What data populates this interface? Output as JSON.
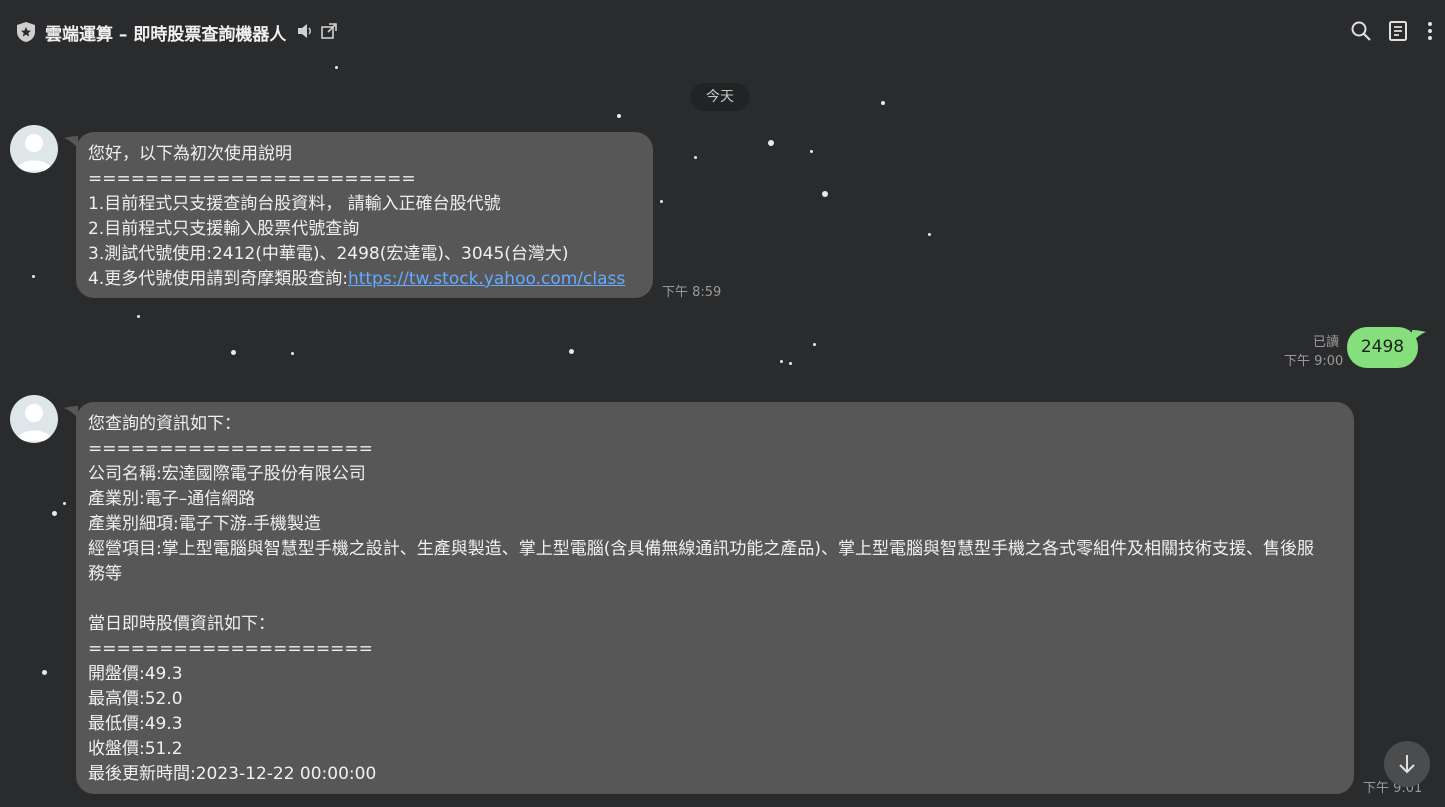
{
  "header": {
    "title": "雲端運算 – 即時股票查詢機器人"
  },
  "chat": {
    "date_divider": "今天",
    "messages": [
      {
        "lines": [
          "您好，以下為初次使用說明",
          "=======================",
          "1.目前程式只支援查詢台股資料， 請輸入正確台股代號",
          "2.目前程式只支援輸入股票代號查詢",
          "3.測試代號使用:2412(中華電)、2498(宏達電)、3045(台灣大)"
        ],
        "last_prefix": "4.更多代號使用請到奇摩類股查詢:",
        "link": "https://tw.stock.yahoo.com/class",
        "time": "下午 8:59"
      },
      {
        "text": "2498",
        "read": "已讀",
        "time": "下午 9:00"
      },
      {
        "lines": [
          "您查詢的資訊如下：",
          "====================",
          "公司名稱:宏達國際電子股份有限公司",
          "產業別:電子–通信網路",
          "產業別細項:電子下游-手機製造"
        ],
        "business": "經營項目:掌上型電腦與智慧型手機之設計、生產與製造、掌上型電腦(含具備無線通訊功能之產品)、掌上型電腦與智慧型手機之各式零組件及相關技術支援、售後服務等",
        "lines2": [
          "當日即時股價資訊如下：",
          "====================",
          "開盤價:49.3",
          "最高價:52.0",
          "最低價:49.3",
          "收盤價:51.2",
          "最後更新時間:2023-12-22 00:00:00"
        ],
        "time": "下午 9:01"
      }
    ]
  }
}
